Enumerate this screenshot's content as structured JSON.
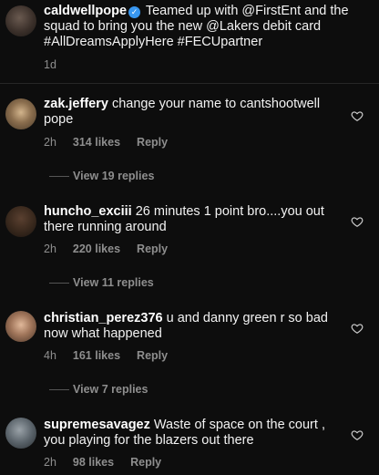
{
  "caption": {
    "username": "caldwellpope",
    "verified_glyph": "✓",
    "text": "Teamed up with @FirstEnt and the squad to bring you the new @Lakers debit card #AllDreamsApplyHere #FECUpartner",
    "time": "1d"
  },
  "comments": [
    {
      "username": "zak.jeffery",
      "text": "change your name to cantshootwell pope",
      "time": "2h",
      "likes": "314 likes",
      "reply_label": "Reply",
      "view_replies": "View 19 replies"
    },
    {
      "username": "huncho_exciii",
      "text": "26 minutes 1 point bro....you out there running around",
      "time": "2h",
      "likes": "220 likes",
      "reply_label": "Reply",
      "view_replies": "View 11 replies"
    },
    {
      "username": "christian_perez376",
      "text": "u and danny green r so bad now what happened",
      "time": "4h",
      "likes": "161 likes",
      "reply_label": "Reply",
      "view_replies": "View 7 replies"
    },
    {
      "username": "supremesavagez",
      "text": "Waste of space on the court , you playing for the blazers out there",
      "time": "2h",
      "likes": "98 likes",
      "reply_label": "Reply"
    }
  ]
}
